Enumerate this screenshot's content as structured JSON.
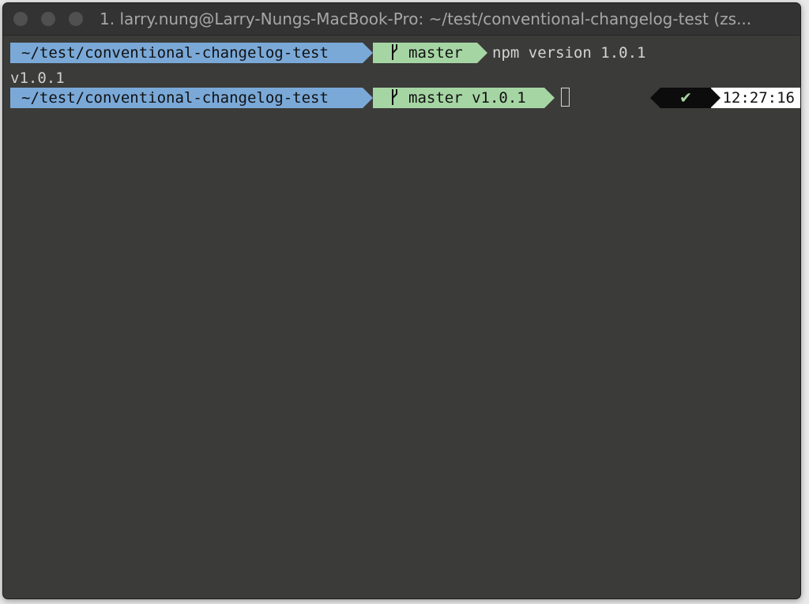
{
  "window": {
    "title": "1. larry.nung@Larry-Nungs-MacBook-Pro: ~/test/conventional-changelog-test (zs..."
  },
  "terminal": {
    "prompt1": {
      "path": "~/test/conventional-changelog-test",
      "branch": "master",
      "command": "npm version 1.0.1"
    },
    "output": "v1.0.1",
    "prompt2": {
      "path": "~/test/conventional-changelog-test",
      "branch": "master v1.0.1",
      "status_icon": "✔",
      "time": "12:27:16"
    }
  },
  "icons": {
    "traffic_lights": [
      "close-button",
      "minimize-button",
      "zoom-button"
    ],
    "branch": "git-branch-icon",
    "status": "check-icon"
  },
  "colors": {
    "path_segment": "#7aa9d8",
    "git_segment": "#a6d5a4",
    "terminal_bg": "#3b3b39",
    "titlebar_bg": "#333333"
  }
}
